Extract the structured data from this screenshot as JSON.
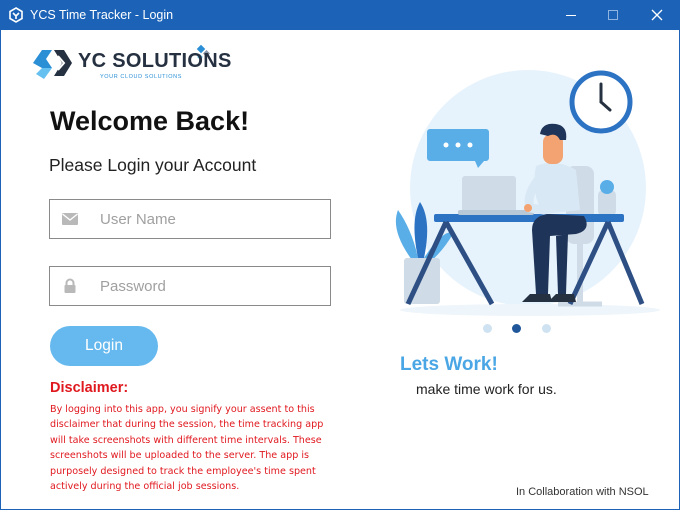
{
  "window": {
    "title": "YCS Time Tracker - Login",
    "accent_color": "#1c63b7",
    "controls": [
      "minimize",
      "maximize",
      "close"
    ]
  },
  "brand": {
    "name": "YC SOLUTIONS",
    "tagline": "YOUR CLOUD SOLUTIONS"
  },
  "login": {
    "heading": "Welcome Back!",
    "subtitle": "Please Login your Account",
    "username": {
      "placeholder": "User Name",
      "value": "",
      "icon": "envelope-icon"
    },
    "password": {
      "placeholder": "Password",
      "value": "",
      "icon": "lock-icon"
    },
    "button_label": "Login",
    "button_color": "#66b9ee"
  },
  "disclaimer": {
    "title": "Disclaimer:",
    "text": "By logging into this app, you signify your assent to this disclaimer that during the session, the time tracking app will take screenshots with different time intervals. These screenshots will be uploaded to the server. The app is purposely designed to track the employee's time spent actively during the official job sessions.",
    "color": "#e0191f"
  },
  "carousel": {
    "slide_count": 3,
    "active_slide": 2,
    "heading": "Lets Work!",
    "caption": "make time work for us."
  },
  "footer": {
    "collaboration": "In Collaboration with NSOL"
  }
}
